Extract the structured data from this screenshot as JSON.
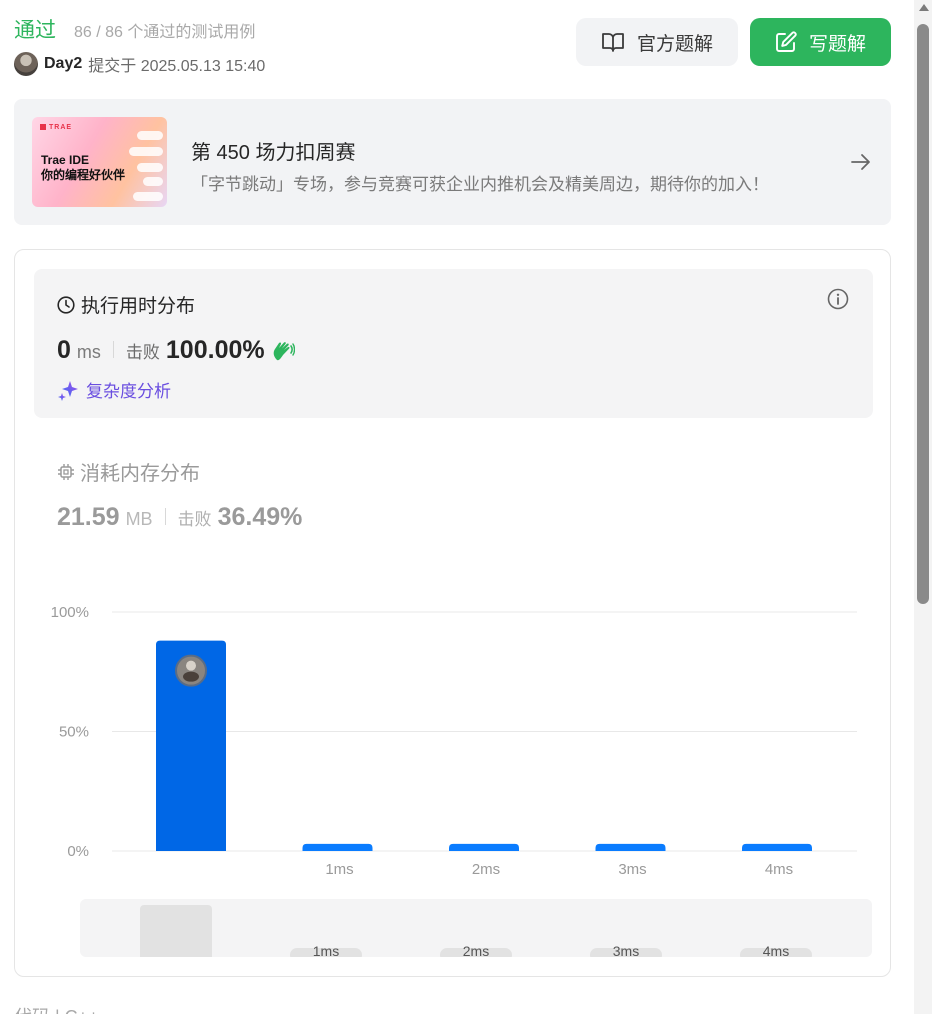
{
  "header": {
    "status": "通过",
    "passed_count": "86 / 86 个通过的测试用例",
    "username": "Day2",
    "submit_time": "提交于 2025.05.13 15:40",
    "official_solution_label": "官方题解",
    "write_solution_label": "写题解"
  },
  "banner": {
    "image_logo": "TRAE",
    "image_title_line1": "Trae IDE",
    "image_title_line2": "你的编程好伙伴",
    "title": "第 450 场力扣周赛",
    "description": "「字节跳动」专场，参与竞赛可获企业内推机会及精美周边，期待你的加入！"
  },
  "runtime": {
    "title": "执行用时分布",
    "value": "0",
    "unit": "ms",
    "beat_label": "击败",
    "beat_percent": "100.00%",
    "complexity_label": "复杂度分析"
  },
  "memory": {
    "title": "消耗内存分布",
    "value": "21.59",
    "unit": "MB",
    "beat_label": "击败",
    "beat_percent": "36.49%"
  },
  "chart_data": {
    "type": "bar",
    "categories": [
      "",
      "1ms",
      "2ms",
      "3ms",
      "4ms"
    ],
    "values": [
      88,
      3,
      3,
      3,
      3
    ],
    "highlighted_index": 0,
    "ylim": [
      0,
      100
    ],
    "yticks": [
      "0%",
      "50%",
      "100%"
    ],
    "grid": true,
    "colors": {
      "highlight": "#0067e6",
      "bar": "#0a7cff",
      "grid": "#e8e8e8",
      "tick": "#9a9a9a"
    }
  },
  "mini_chart": {
    "labels": [
      "",
      "1ms",
      "2ms",
      "3ms",
      "4ms"
    ]
  },
  "footer": {
    "code_label": "代码 | C++"
  },
  "colors": {
    "accent_green": "#2db55d",
    "panel_bg": "#f4f4f5",
    "complexity_purple": "#6a4ee0"
  }
}
